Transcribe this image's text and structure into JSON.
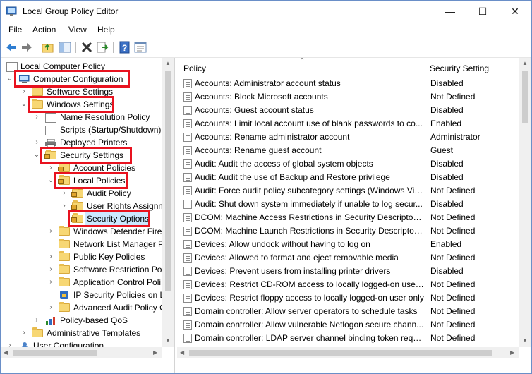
{
  "window": {
    "title": "Local Group Policy Editor",
    "minimize": "—",
    "maximize": "☐",
    "close": "✕"
  },
  "menu": [
    "File",
    "Action",
    "View",
    "Help"
  ],
  "toolbar_icons": [
    "back-icon",
    "forward-icon",
    "up-folder-icon",
    "show-hide-tree-icon",
    "delete-icon",
    "export-list-icon",
    "help-icon",
    "properties-icon"
  ],
  "tree": {
    "items": [
      {
        "label": "Local Computer Policy"
      },
      {
        "label": "Computer Configuration",
        "expanded": true,
        "highlighted": true
      },
      {
        "label": "Software Settings"
      },
      {
        "label": "Windows Settings",
        "expanded": true,
        "highlighted": true
      },
      {
        "label": "Name Resolution Policy"
      },
      {
        "label": "Scripts (Startup/Shutdown)"
      },
      {
        "label": "Deployed Printers"
      },
      {
        "label": "Security Settings",
        "expanded": true,
        "highlighted": true
      },
      {
        "label": "Account Policies"
      },
      {
        "label": "Local Policies",
        "expanded": true,
        "highlighted": true
      },
      {
        "label": "Audit Policy"
      },
      {
        "label": "User Rights Assignm"
      },
      {
        "label": "Security Options",
        "selected": true,
        "highlighted": true
      },
      {
        "label": "Windows Defender Firew"
      },
      {
        "label": "Network List Manager P"
      },
      {
        "label": "Public Key Policies"
      },
      {
        "label": "Software Restriction Poli"
      },
      {
        "label": "Application Control Poli"
      },
      {
        "label": "IP Security Policies on L"
      },
      {
        "label": "Advanced Audit Policy C"
      },
      {
        "label": "Policy-based QoS"
      },
      {
        "label": "Administrative Templates"
      },
      {
        "label": "User Configuration"
      }
    ]
  },
  "list": {
    "columns": [
      "Policy",
      "Security Setting"
    ],
    "rows": [
      {
        "policy": "Accounts: Administrator account status",
        "setting": "Disabled"
      },
      {
        "policy": "Accounts: Block Microsoft accounts",
        "setting": "Not Defined"
      },
      {
        "policy": "Accounts: Guest account status",
        "setting": "Disabled"
      },
      {
        "policy": "Accounts: Limit local account use of blank passwords to co...",
        "setting": "Enabled"
      },
      {
        "policy": "Accounts: Rename administrator account",
        "setting": "Administrator"
      },
      {
        "policy": "Accounts: Rename guest account",
        "setting": "Guest"
      },
      {
        "policy": "Audit: Audit the access of global system objects",
        "setting": "Disabled"
      },
      {
        "policy": "Audit: Audit the use of Backup and Restore privilege",
        "setting": "Disabled"
      },
      {
        "policy": "Audit: Force audit policy subcategory settings (Windows Vis...",
        "setting": "Not Defined"
      },
      {
        "policy": "Audit: Shut down system immediately if unable to log secur...",
        "setting": "Disabled"
      },
      {
        "policy": "DCOM: Machine Access Restrictions in Security Descriptor D...",
        "setting": "Not Defined"
      },
      {
        "policy": "DCOM: Machine Launch Restrictions in Security Descriptor ...",
        "setting": "Not Defined"
      },
      {
        "policy": "Devices: Allow undock without having to log on",
        "setting": "Enabled"
      },
      {
        "policy": "Devices: Allowed to format and eject removable media",
        "setting": "Not Defined"
      },
      {
        "policy": "Devices: Prevent users from installing printer drivers",
        "setting": "Disabled"
      },
      {
        "policy": "Devices: Restrict CD-ROM access to locally logged-on user ...",
        "setting": "Not Defined"
      },
      {
        "policy": "Devices: Restrict floppy access to locally logged-on user only",
        "setting": "Not Defined"
      },
      {
        "policy": "Domain controller: Allow server operators to schedule tasks",
        "setting": "Not Defined"
      },
      {
        "policy": "Domain controller: Allow vulnerable Netlogon secure chann...",
        "setting": "Not Defined"
      },
      {
        "policy": "Domain controller: LDAP server channel binding token requi...",
        "setting": "Not Defined"
      }
    ]
  },
  "colors": {
    "highlight_box": "#e8121f",
    "selection": "#cce8ff",
    "folder": "#f7d774"
  }
}
